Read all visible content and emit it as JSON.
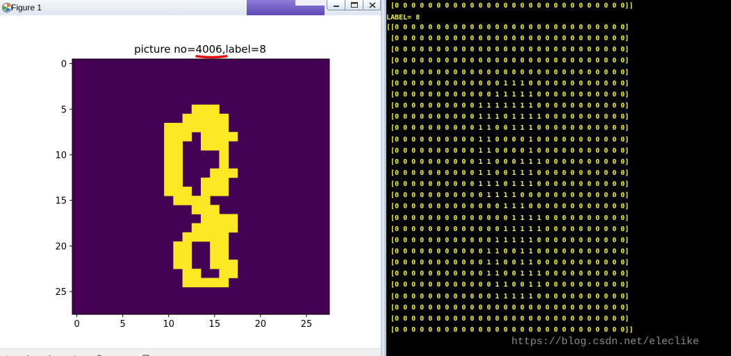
{
  "window": {
    "title": "Figure 1"
  },
  "figure": {
    "title_prefix": "picture no=",
    "picture_no": "4006",
    "title_suffix": ",label=8",
    "underline_color": "#e01010",
    "x_ticks": [
      "0",
      "5",
      "10",
      "15",
      "20",
      "25"
    ],
    "y_ticks": [
      "0",
      "5",
      "10",
      "15",
      "20",
      "25"
    ],
    "colors": {
      "background": "#440154",
      "foreground": "#fde725"
    },
    "grid": [
      "0000000000000000000000000000",
      "0000000000000000000000000000",
      "0000000000000000000000000000",
      "0000000000000000000000000000",
      "0000000000000000000000000000",
      "0000000000000111000000000000",
      "0000000000001111100000000000",
      "0000000000111111100000000000",
      "0000000000111011110000000000",
      "0000000000110011100000000000",
      "0000000000110000100000000000",
      "0000000000110000100000000000",
      "0000000000110001110000000000",
      "0000000000110011100000000000",
      "0000000000111011100000000000",
      "0000000000011110000000000000",
      "0000000000000111000000000000",
      "0000000000000011110000000000",
      "0000000000000111110000000000",
      "0000000000001111100000000000",
      "0000000000011001100000000000",
      "0000000000011001100000000000",
      "0000000000011001110000000000",
      "0000000000001100110000000000",
      "0000000000001111100000000000",
      "0000000000000000000000000000",
      "0000000000000000000000000000",
      "0000000000000000000000000000"
    ]
  },
  "console": {
    "top_line": " [0 0 0 0 0 0 0 0 0 0 0 0 0 0 0 0 0 0 0 0 0 0 0 0 0 0 0 0]]",
    "label_line": "LABEL= 8",
    "matrix_lines": [
      "[[0 0 0 0 0 0 0 0 0 0 0 0 0 0 0 0 0 0 0 0 0 0 0 0 0 0 0 0]",
      " [0 0 0 0 0 0 0 0 0 0 0 0 0 0 0 0 0 0 0 0 0 0 0 0 0 0 0 0]",
      " [0 0 0 0 0 0 0 0 0 0 0 0 0 0 0 0 0 0 0 0 0 0 0 0 0 0 0 0]",
      " [0 0 0 0 0 0 0 0 0 0 0 0 0 0 0 0 0 0 0 0 0 0 0 0 0 0 0 0]",
      " [0 0 0 0 0 0 0 0 0 0 0 0 0 0 0 0 0 0 0 0 0 0 0 0 0 0 0 0]",
      " [0 0 0 0 0 0 0 0 0 0 0 0 0 1 1 1 0 0 0 0 0 0 0 0 0 0 0 0]",
      " [0 0 0 0 0 0 0 0 0 0 0 0 1 1 1 1 1 0 0 0 0 0 0 0 0 0 0 0]",
      " [0 0 0 0 0 0 0 0 0 0 1 1 1 1 1 1 1 0 0 0 0 0 0 0 0 0 0 0]",
      " [0 0 0 0 0 0 0 0 0 0 1 1 1 0 1 1 1 1 0 0 0 0 0 0 0 0 0 0]",
      " [0 0 0 0 0 0 0 0 0 0 1 1 0 0 1 1 1 0 0 0 0 0 0 0 0 0 0 0]",
      " [0 0 0 0 0 0 0 0 0 0 1 1 0 0 0 0 1 0 0 0 0 0 0 0 0 0 0 0]",
      " [0 0 0 0 0 0 0 0 0 0 1 1 0 0 0 0 1 0 0 0 0 0 0 0 0 0 0 0]",
      " [0 0 0 0 0 0 0 0 0 0 1 1 0 0 0 1 1 1 0 0 0 0 0 0 0 0 0 0]",
      " [0 0 0 0 0 0 0 0 0 0 1 1 0 0 1 1 1 0 0 0 0 0 0 0 0 0 0 0]",
      " [0 0 0 0 0 0 0 0 0 0 1 1 1 0 1 1 1 0 0 0 0 0 0 0 0 0 0 0]",
      " [0 0 0 0 0 0 0 0 0 0 0 1 1 1 1 0 0 0 0 0 0 0 0 0 0 0 0 0]",
      " [0 0 0 0 0 0 0 0 0 0 0 0 0 1 1 1 0 0 0 0 0 0 0 0 0 0 0 0]",
      " [0 0 0 0 0 0 0 0 0 0 0 0 0 0 1 1 1 1 0 0 0 0 0 0 0 0 0 0]",
      " [0 0 0 0 0 0 0 0 0 0 0 0 0 1 1 1 1 1 0 0 0 0 0 0 0 0 0 0]",
      " [0 0 0 0 0 0 0 0 0 0 0 0 1 1 1 1 1 0 0 0 0 0 0 0 0 0 0 0]",
      " [0 0 0 0 0 0 0 0 0 0 0 1 1 0 0 1 1 0 0 0 0 0 0 0 0 0 0 0]",
      " [0 0 0 0 0 0 0 0 0 0 0 1 1 0 0 1 1 0 0 0 0 0 0 0 0 0 0 0]",
      " [0 0 0 0 0 0 0 0 0 0 0 1 1 0 0 1 1 1 0 0 0 0 0 0 0 0 0 0]",
      " [0 0 0 0 0 0 0 0 0 0 0 0 1 1 0 0 1 1 0 0 0 0 0 0 0 0 0 0]",
      " [0 0 0 0 0 0 0 0 0 0 0 0 1 1 1 1 1 0 0 0 0 0 0 0 0 0 0 0]",
      " [0 0 0 0 0 0 0 0 0 0 0 0 0 0 0 0 0 0 0 0 0 0 0 0 0 0 0 0]",
      " [0 0 0 0 0 0 0 0 0 0 0 0 0 0 0 0 0 0 0 0 0 0 0 0 0 0 0 0]",
      " [0 0 0 0 0 0 0 0 0 0 0 0 0 0 0 0 0 0 0 0 0 0 0 0 0 0 0 0]]"
    ],
    "watermark": "https://blog.csdn.net/eleclike",
    "text_color": "#f2f23c"
  }
}
